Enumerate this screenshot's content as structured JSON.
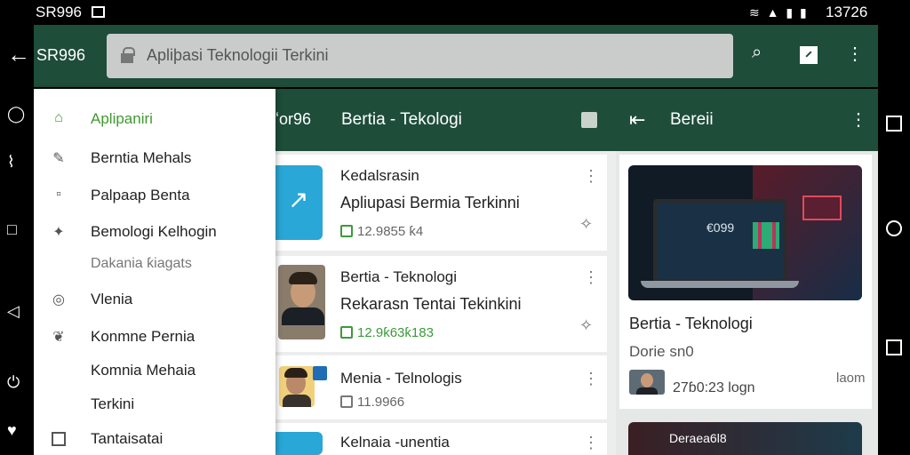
{
  "status_bar": {
    "carrier": "SR996",
    "time": "13726",
    "icons": [
      "image-icon",
      "wifi-icon",
      "signal-icon",
      "battery-icon"
    ]
  },
  "app_bar": {
    "title": "SR996",
    "search_text": "Apliþasi Teknologii Terkini",
    "actions": [
      "search-icon",
      "pip-icon",
      "more-icon"
    ]
  },
  "sub_bar": {
    "prefix": "ʻor96",
    "title": "Bertia - Tekologi",
    "right_title": "Bereii"
  },
  "drawer": {
    "items": [
      {
        "label": "Aplipaniri",
        "icon": "home-icon",
        "active": true
      },
      {
        "label": "Berntia Mehals",
        "icon": "edit-icon"
      },
      {
        "label": "Palpaap Benta",
        "icon": "square-icon"
      },
      {
        "label": "Bemologi Kelhogin",
        "icon": "puzzle-icon"
      },
      {
        "label": "Dakania ƙiagats",
        "icon": "",
        "sub": true
      },
      {
        "label": "Vlenia",
        "icon": "compass-icon"
      },
      {
        "label": "Konmne Pernia",
        "icon": "leaf-icon"
      },
      {
        "label": "Komnia Mehaia",
        "icon": ""
      },
      {
        "label": "Terkini",
        "icon": ""
      },
      {
        "label": "Tantaisatai",
        "icon": "checkbox-icon"
      }
    ]
  },
  "articles": [
    {
      "line1": "Kedalsrasin",
      "line2": "Apliupasi Bermia Terkinni",
      "meta": "12.9855 ƙ4",
      "meta_color": "gray"
    },
    {
      "line1": "Bertia - Teknologi",
      "line2": "Rekarasn Tentai Tekinkini",
      "meta": "12.9ƙ63ƙ183",
      "meta_color": "green"
    },
    {
      "line1": "Menia - Telnologis",
      "line2": "",
      "meta": "11.9966",
      "meta_color": "gray"
    },
    {
      "line1": "Kelnaia -unentia",
      "line2": "",
      "meta": "",
      "meta_color": "gray"
    }
  ],
  "featured": {
    "image_text": "€099",
    "title": "Bertia - Teknologi",
    "subtitle": "Dorie sn0",
    "meta": "27ɓ0:23 logn",
    "time": "laom"
  },
  "featured2": {
    "title": "Deraea6l8"
  }
}
